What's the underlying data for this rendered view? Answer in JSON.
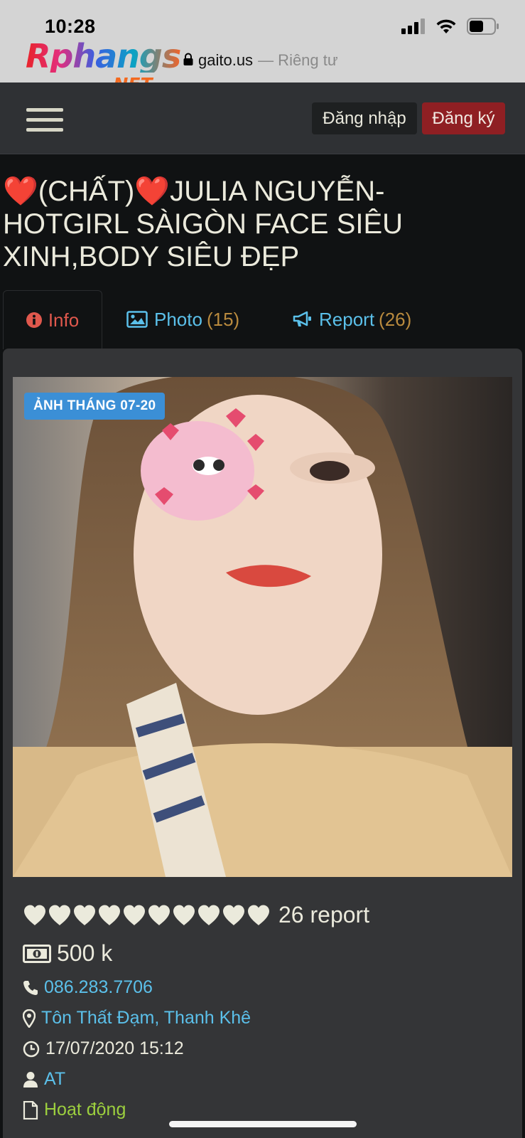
{
  "status_bar": {
    "time": "10:28"
  },
  "browser": {
    "logo_text": "Rphangs",
    "logo_suffix": ".NET",
    "domain": "gaito.us",
    "privacy": "— Riêng tư"
  },
  "nav": {
    "login_label": "Đăng nhập",
    "signup_label": "Đăng ký"
  },
  "listing": {
    "title": "❤️(CHẤT)❤️JULIA NGUYỄN-HOTGIRL SÀIGÒN FACE SIÊU XINH,BODY SIÊU ĐẸP",
    "tabs": [
      {
        "label": "Info"
      },
      {
        "label": "Photo",
        "count": "(15)"
      },
      {
        "label": "Report",
        "count": "(26)"
      }
    ],
    "photo_badge": "ẢNH THÁNG 07-20",
    "hearts": 10,
    "report_count": "26 report",
    "price": "500 k",
    "phone": "086.283.7706",
    "address": "Tôn Thất Đạm, Thanh Khê",
    "datetime": "17/07/2020 15:12",
    "user": "AT",
    "status": "Hoạt động"
  },
  "colors": {
    "accent_link": "#5bc0ea",
    "active_tab": "#e0584d",
    "count": "#b98a3e",
    "signup_button": "#8f1f23",
    "badge": "#3b8fd6",
    "status_active": "#9ccf3e"
  },
  "icons": [
    "signal-icon",
    "wifi-icon",
    "battery-icon",
    "lock-icon",
    "hamburger-menu-icon",
    "info-icon",
    "image-icon",
    "megaphone-icon",
    "heart-icon",
    "money-icon",
    "phone-icon",
    "map-marker-icon",
    "clock-icon",
    "user-icon",
    "file-icon"
  ]
}
